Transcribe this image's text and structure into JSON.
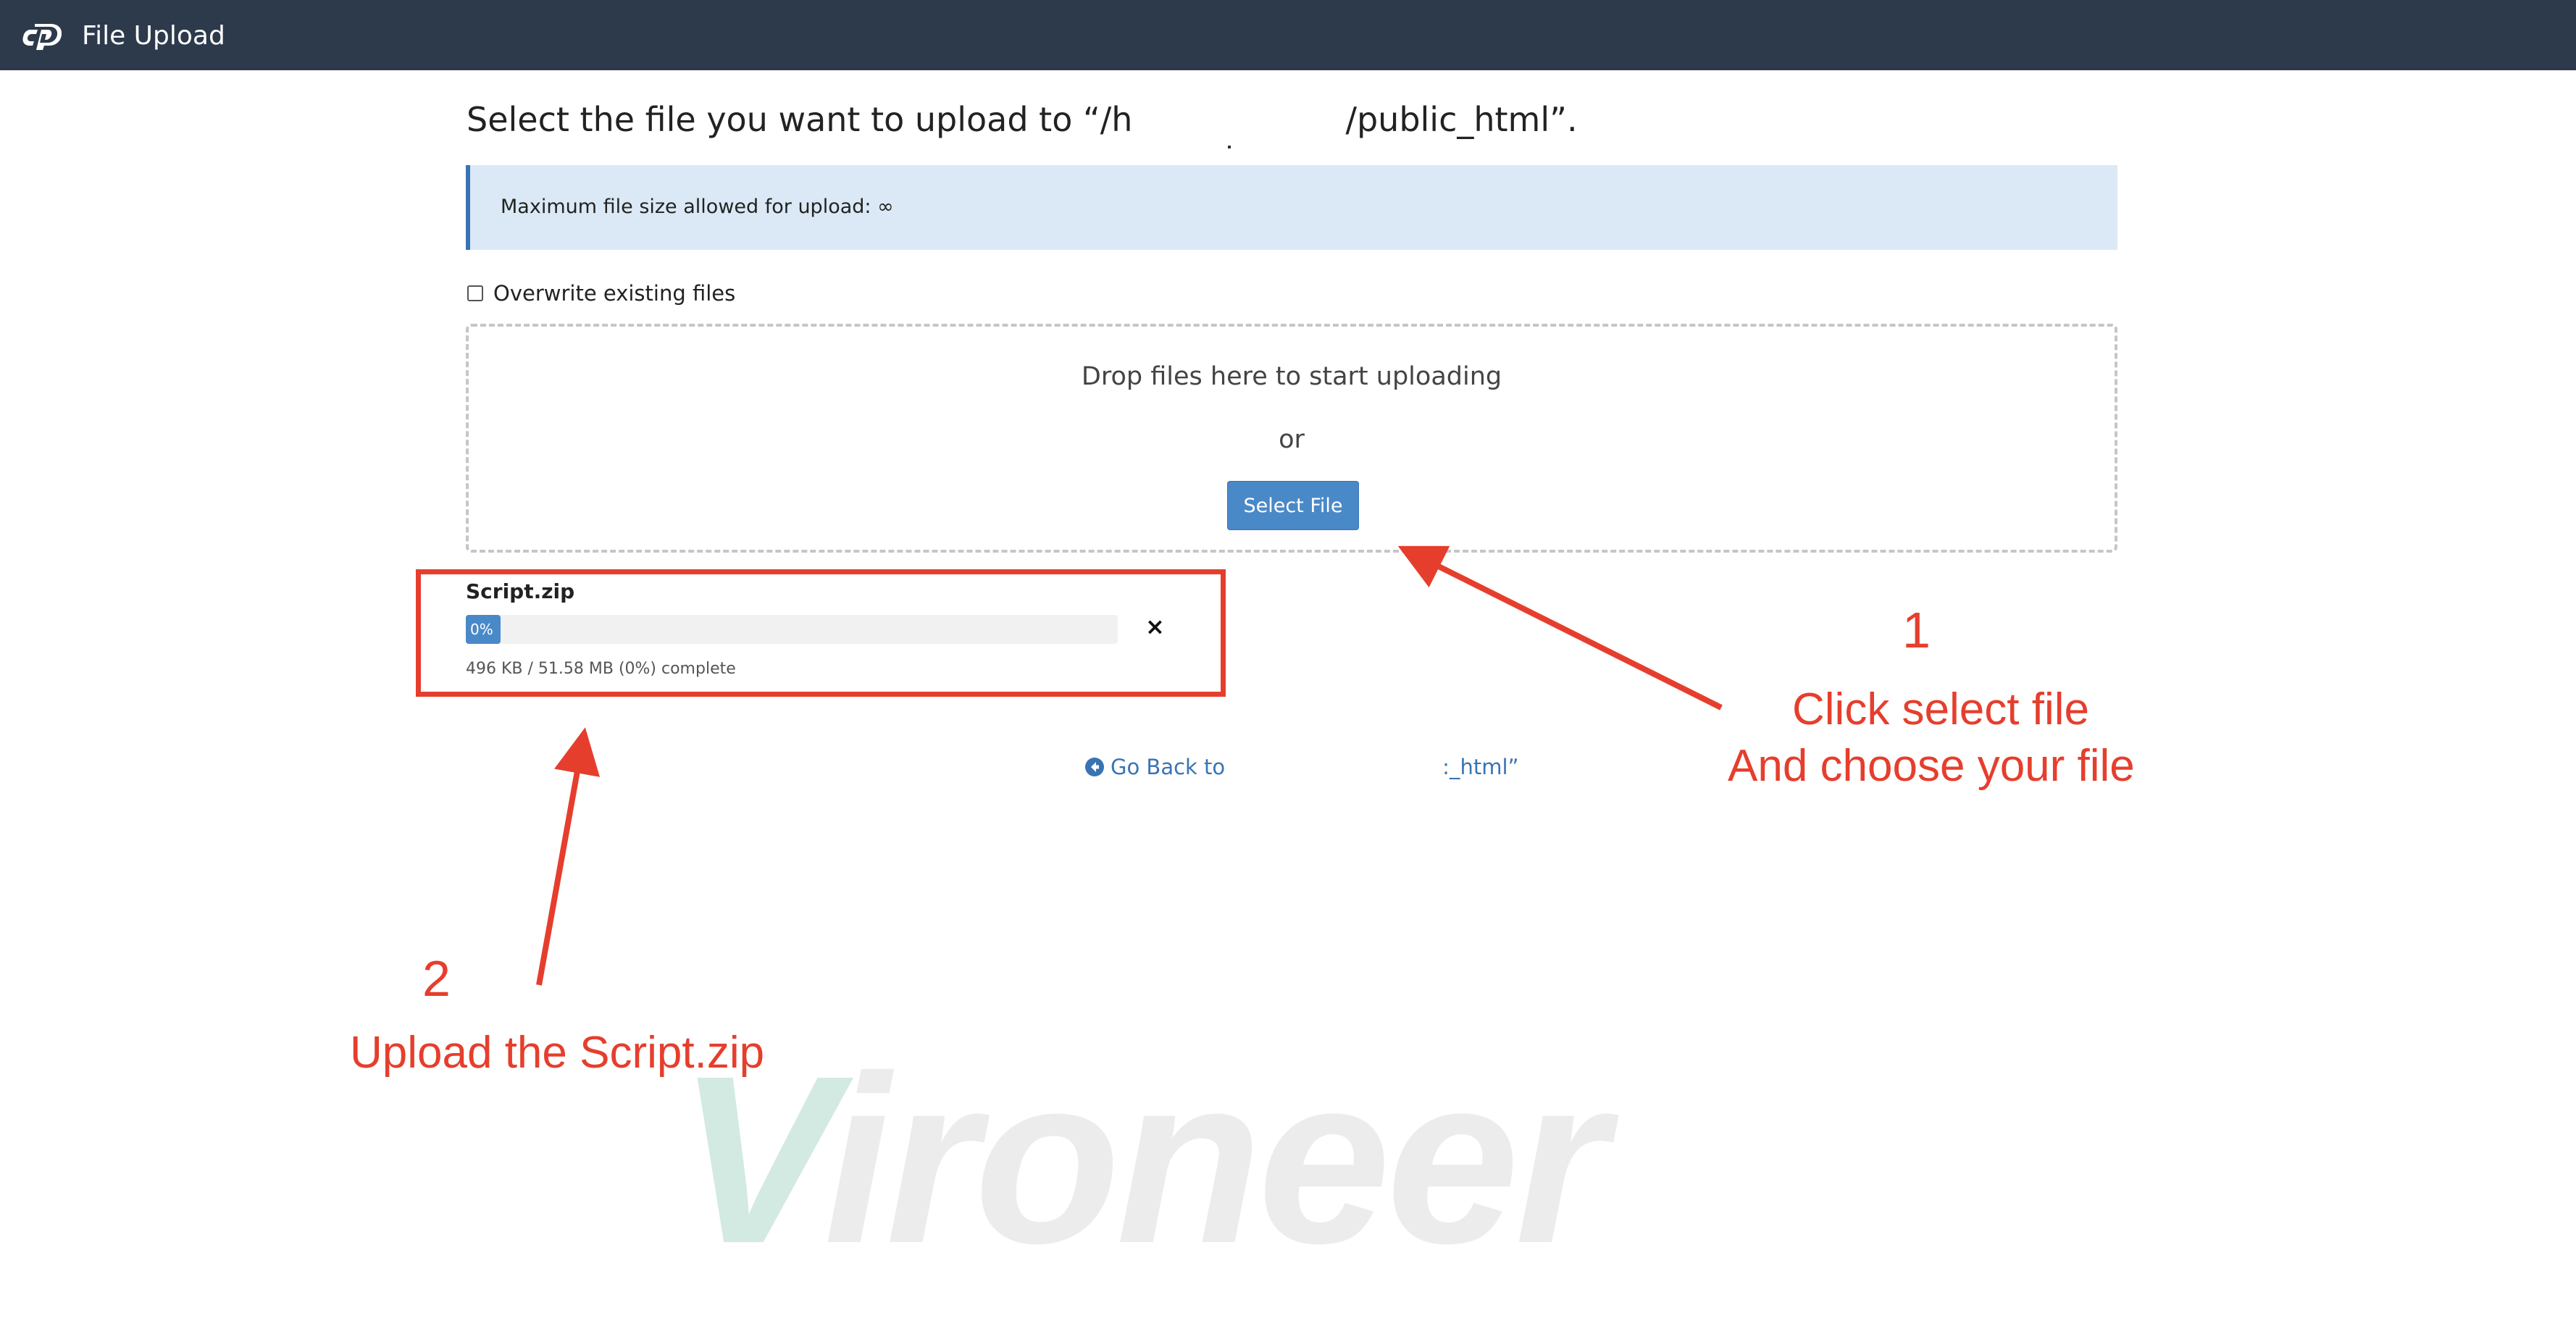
{
  "topbar": {
    "logo_icon": "cpanel-logo-icon",
    "title": "File Upload",
    "background": "#2d3a4b"
  },
  "main": {
    "heading_prefix": "Select the file you want to upload to “/h",
    "heading_suffix": "/public_html”.",
    "info_text": "Maximum file size allowed for upload: ∞",
    "overwrite_label": "Overwrite existing files",
    "overwrite_checked": false,
    "dropzone": {
      "drop_text": "Drop files here to start uploading",
      "or_text": "or",
      "select_button": "Select File"
    },
    "upload": {
      "file_name": "Script.zip",
      "progress_label": "0%",
      "progress_fraction": 0.0,
      "progress_text": "496 KB / 51.58 MB (0%) complete",
      "cancel_icon": "close-icon",
      "cancel_label": "×"
    },
    "go_back": {
      "icon": "arrow-left-circle-icon",
      "prefix": "Go Back to",
      "suffix": ":_html”"
    }
  },
  "annotations": {
    "color": "#e63e2d",
    "step1_number": "1",
    "step1_line1": "Click select file",
    "step1_line2": "And choose your file",
    "step2_number": "2",
    "step2_line1": "Upload the Script.zip"
  },
  "watermark": {
    "first_letter": "V",
    "rest": "ironeer",
    "first_color": "#d3eae2",
    "rest_color": "#ececec"
  }
}
